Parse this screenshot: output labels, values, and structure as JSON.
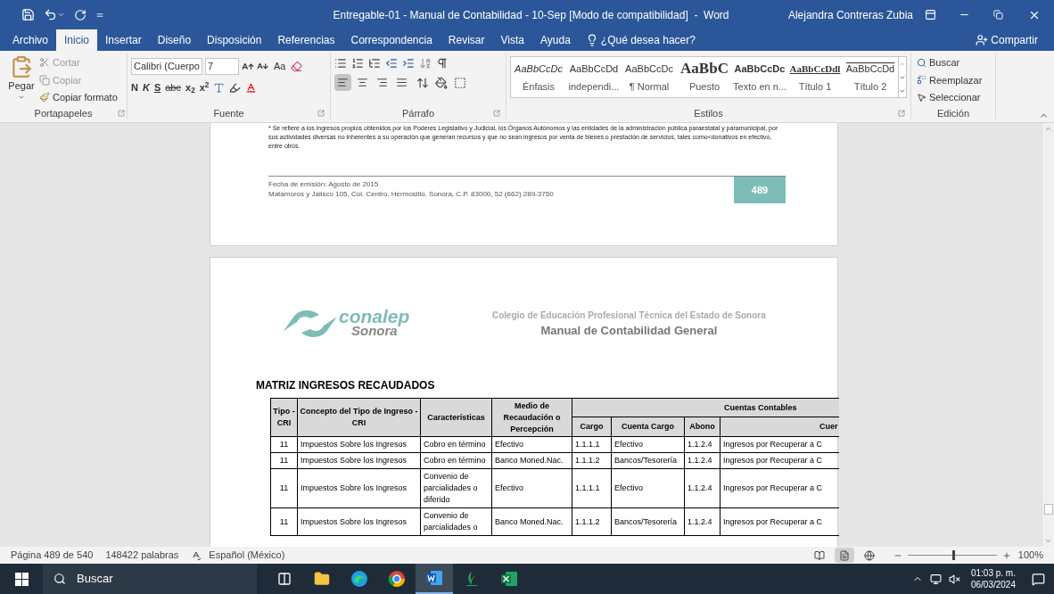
{
  "window": {
    "title": "Entregable-01 - Manual de Contabilidad - 10-Sep [Modo de compatibilidad]  -  Word",
    "user": "Alejandra Contreras Zubia"
  },
  "tabs": [
    {
      "label": "Archivo",
      "selected": false
    },
    {
      "label": "Inicio",
      "selected": true
    },
    {
      "label": "Insertar",
      "selected": false
    },
    {
      "label": "Diseño",
      "selected": false
    },
    {
      "label": "Disposición",
      "selected": false
    },
    {
      "label": "Referencias",
      "selected": false
    },
    {
      "label": "Correspondencia",
      "selected": false
    },
    {
      "label": "Revisar",
      "selected": false
    },
    {
      "label": "Vista",
      "selected": false
    },
    {
      "label": "Ayuda",
      "selected": false
    }
  ],
  "tell_me": "¿Qué desea hacer?",
  "share": "Compartir",
  "clipboard": {
    "paste": "Pegar",
    "cut": "Cortar",
    "copy": "Copiar",
    "format_painter": "Copiar formato",
    "label": "Portapapeles"
  },
  "font": {
    "name": "Calibri (Cuerpo",
    "size": "7",
    "case": "Aa",
    "label": "Fuente",
    "format_buttons": [
      {
        "kind": "bold",
        "label": "N"
      },
      {
        "kind": "italic",
        "label": "K"
      },
      {
        "kind": "underline",
        "label": "S"
      },
      {
        "kind": "strike",
        "label": "abc"
      },
      {
        "kind": "sub",
        "label": "x$_{2}$"
      },
      {
        "kind": "sup",
        "label": "x$^{2}$"
      }
    ]
  },
  "paragraph": {
    "label": "Párrafo",
    "alignments": [
      {
        "kind": "left",
        "selected": true
      },
      {
        "kind": "center",
        "selected": false
      },
      {
        "kind": "right",
        "selected": false
      },
      {
        "kind": "justify",
        "selected": false
      }
    ]
  },
  "styles": {
    "label": "Estilos",
    "items": [
      {
        "kind": "emphasis",
        "preview": "AaBbCcDc",
        "name": "Énfasis"
      },
      {
        "kind": "plain",
        "preview": "AaBbCcDd",
        "name": "independi..."
      },
      {
        "kind": "plain",
        "preview": "AaBbCcDc",
        "name": "¶ Normal"
      },
      {
        "kind": "title",
        "preview": "AaBbC",
        "name": "Puesto"
      },
      {
        "kind": "strong",
        "preview": "AaBbCcDc",
        "name": "Texto en n..."
      },
      {
        "kind": "heading1",
        "preview": "AaBbCcDdl",
        "name": "Título 1"
      },
      {
        "kind": "heading2",
        "preview": "AaBbCcDd",
        "name": "Título 2"
      }
    ]
  },
  "editing": {
    "find": "Buscar",
    "replace": "Reemplazar",
    "select": "Seleccionar",
    "label": "Edición"
  },
  "page1": {
    "footnote": "* Se refiere a los ingresos propios obtenidos por los Poderes Legislativo y Judicial, los Órganos Autónomos y las entidades de la administración pública paraestatal y paramunicipal, por sus actividades diversas no inherentes a su operación que generan recursos y que no sean ingresos por venta de bienes o prestación de servicios, tales como<donativos en efectivo, entre otros.",
    "issue_date": "Fecha de emisión: Agosto de 2015",
    "address": "Matamoros y Jalisco 105, Col. Centro. Hermosillo, Sonora, C.P. 83000, 52 (662) 289-3750",
    "page_number": "489"
  },
  "page2": {
    "logo": {
      "name": "conalep",
      "region": "Sonora"
    },
    "institution": "Colegio de Educación Profesional Técnica del Estado de Sonora",
    "manual": "Manual de Contabilidad General",
    "heading": "MATRIZ INGRESOS RECAUDADOS",
    "table": {
      "columns": [
        "Tipo - CRI",
        "Concepto del Tipo de Ingreso - CRI",
        "Características",
        "Medio de Recaudación o Percepción"
      ],
      "group": "Cuentas Contables",
      "subcolumns": [
        "Cargo",
        "Cuenta Cargo",
        "Abono",
        "Cuer"
      ],
      "rows": [
        [
          "11",
          "Impuestos Sobre los Ingresos",
          "Cobro en término",
          "Efectivo",
          "1.1.1.1",
          "Efectivo",
          "1.1.2.4",
          "Ingresos por Recuperar a C"
        ],
        [
          "11",
          "Impuestos Sobre los Ingresos",
          "Cobro en término",
          "Banco Moned.Nac.",
          "1.1.1.2",
          "Bancos/Tesorería",
          "1.1.2.4",
          "Ingresos por Recuperar a C"
        ],
        [
          "11",
          "Impuestos Sobre los Ingresos",
          "Convenio de parcialidades o diferido",
          "Efectivo",
          "1.1.1.1",
          "Efectivo",
          "1.1.2.4",
          "Ingresos por Recuperar a C"
        ],
        [
          "11",
          "Impuestos Sobre los Ingresos",
          "Convenio de parcialidades o",
          "Banco Moned.Nac.",
          "1.1.1.2",
          "Bancos/Tesorería",
          "1.1.2.4",
          "Ingresos por Recuperar a C"
        ]
      ]
    }
  },
  "status_bar": {
    "page": "Página 489 de 540",
    "words": "148422 palabras",
    "language": "Español (México)",
    "views": [
      {
        "kind": "read",
        "selected": false
      },
      {
        "kind": "print",
        "selected": true
      },
      {
        "kind": "web",
        "selected": false
      }
    ],
    "zoom": "100%",
    "zoom_slider": {
      "level": 0.5
    }
  },
  "taskbar": {
    "search": "Buscar",
    "apps": [
      {
        "kind": "taskview",
        "selected": false
      },
      {
        "kind": "explorer",
        "selected": false
      },
      {
        "kind": "edge",
        "selected": false
      },
      {
        "kind": "chrome",
        "selected": false
      },
      {
        "kind": "word",
        "selected": true
      },
      {
        "kind": "leaf",
        "selected": false
      },
      {
        "kind": "excel",
        "selected": false
      }
    ],
    "time": "01:03 p. m.",
    "date": "06/03/2024"
  }
}
